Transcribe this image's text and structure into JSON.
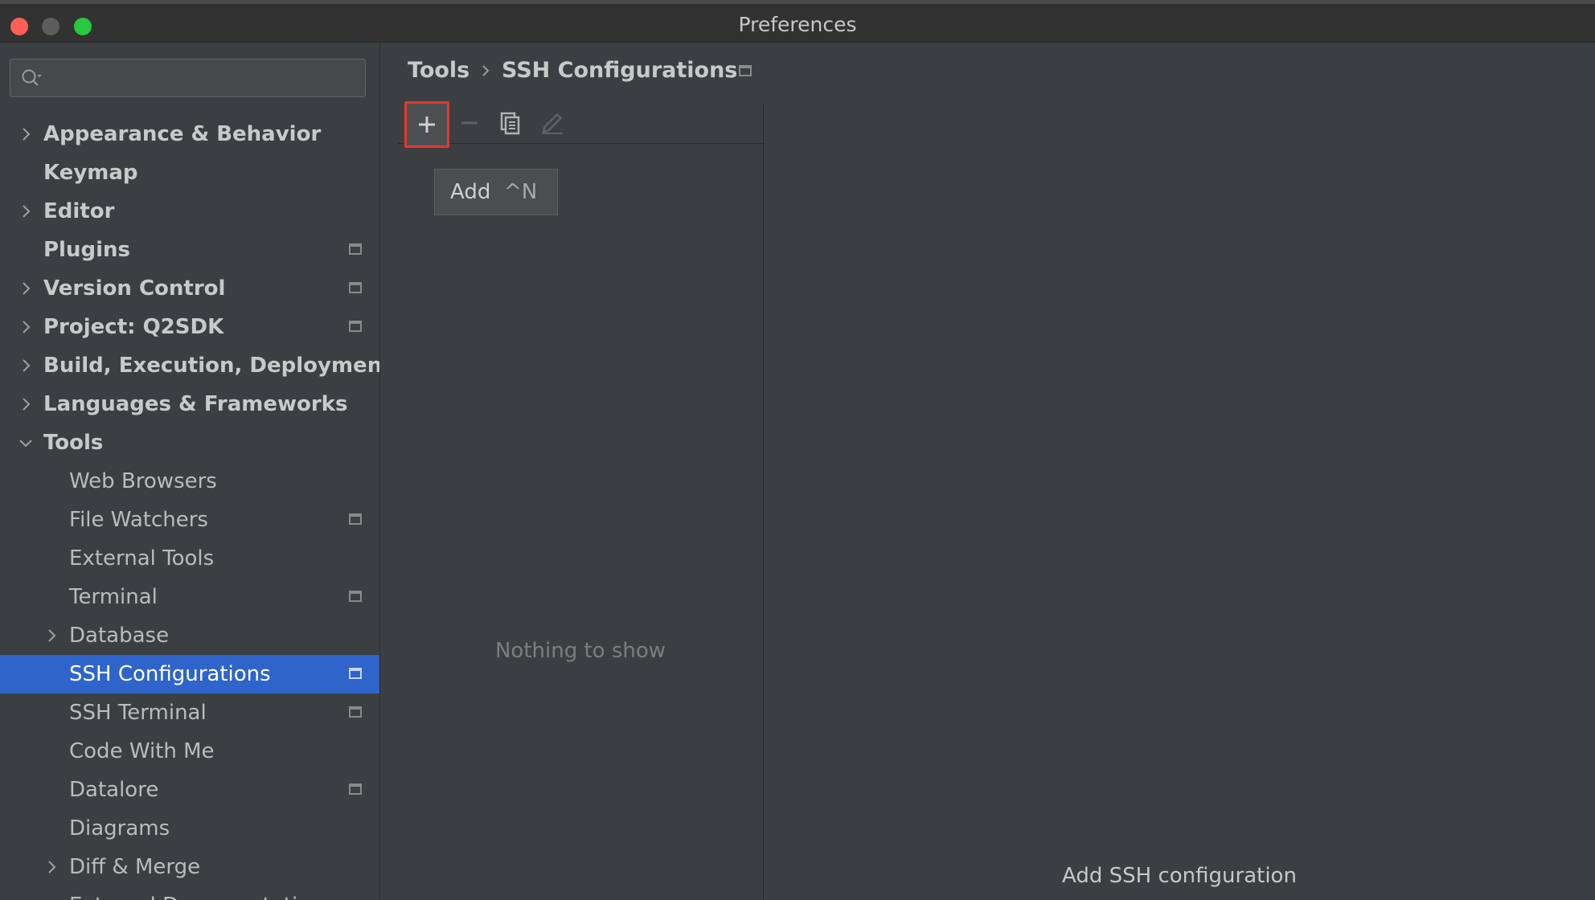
{
  "window": {
    "title": "Preferences"
  },
  "search": {
    "placeholder": "",
    "icon": "search-icon"
  },
  "sidebar": {
    "items": [
      {
        "label": "Appearance & Behavior",
        "level": 0,
        "expandable": true,
        "expanded": false,
        "bold": true,
        "project": false,
        "selected": false
      },
      {
        "label": "Keymap",
        "level": 0,
        "expandable": false,
        "bold": true,
        "project": false,
        "selected": false
      },
      {
        "label": "Editor",
        "level": 0,
        "expandable": true,
        "expanded": false,
        "bold": true,
        "project": false,
        "selected": false
      },
      {
        "label": "Plugins",
        "level": 0,
        "expandable": false,
        "bold": true,
        "project": true,
        "selected": false
      },
      {
        "label": "Version Control",
        "level": 0,
        "expandable": true,
        "expanded": false,
        "bold": true,
        "project": true,
        "selected": false
      },
      {
        "label": "Project: Q2SDK",
        "level": 0,
        "expandable": true,
        "expanded": false,
        "bold": true,
        "project": true,
        "selected": false
      },
      {
        "label": "Build, Execution, Deployment",
        "level": 0,
        "expandable": true,
        "expanded": false,
        "bold": true,
        "project": false,
        "selected": false
      },
      {
        "label": "Languages & Frameworks",
        "level": 0,
        "expandable": true,
        "expanded": false,
        "bold": true,
        "project": false,
        "selected": false
      },
      {
        "label": "Tools",
        "level": 0,
        "expandable": true,
        "expanded": true,
        "bold": true,
        "project": false,
        "selected": false
      },
      {
        "label": "Web Browsers",
        "level": 1,
        "expandable": false,
        "bold": false,
        "project": false,
        "selected": false
      },
      {
        "label": "File Watchers",
        "level": 1,
        "expandable": false,
        "bold": false,
        "project": true,
        "selected": false
      },
      {
        "label": "External Tools",
        "level": 1,
        "expandable": false,
        "bold": false,
        "project": false,
        "selected": false
      },
      {
        "label": "Terminal",
        "level": 1,
        "expandable": false,
        "bold": false,
        "project": true,
        "selected": false
      },
      {
        "label": "Database",
        "level": 1,
        "expandable": true,
        "expanded": false,
        "bold": false,
        "project": false,
        "selected": false
      },
      {
        "label": "SSH Configurations",
        "level": 1,
        "expandable": false,
        "bold": false,
        "project": true,
        "selected": true
      },
      {
        "label": "SSH Terminal",
        "level": 1,
        "expandable": false,
        "bold": false,
        "project": true,
        "selected": false
      },
      {
        "label": "Code With Me",
        "level": 1,
        "expandable": false,
        "bold": false,
        "project": false,
        "selected": false
      },
      {
        "label": "Datalore",
        "level": 1,
        "expandable": false,
        "bold": false,
        "project": true,
        "selected": false
      },
      {
        "label": "Diagrams",
        "level": 1,
        "expandable": false,
        "bold": false,
        "project": false,
        "selected": false
      },
      {
        "label": "Diff & Merge",
        "level": 1,
        "expandable": true,
        "expanded": false,
        "bold": false,
        "project": false,
        "selected": false
      },
      {
        "label": "External Documentation",
        "level": 1,
        "expandable": false,
        "bold": false,
        "project": false,
        "selected": false
      }
    ]
  },
  "breadcrumb": {
    "parent": "Tools",
    "current": "SSH Configurations"
  },
  "toolbar": {
    "add_icon": "plus-icon",
    "remove_icon": "minus-icon",
    "copy_icon": "copy-icon",
    "edit_icon": "edit-icon",
    "highlight_color": "#e8362d"
  },
  "tooltip": {
    "label": "Add",
    "shortcut": "^N"
  },
  "list": {
    "empty_text": "Nothing to show"
  },
  "detail": {
    "hint": "Add SSH configuration"
  },
  "colors": {
    "selection": "#2f65ca",
    "background": "#3c3f41"
  }
}
